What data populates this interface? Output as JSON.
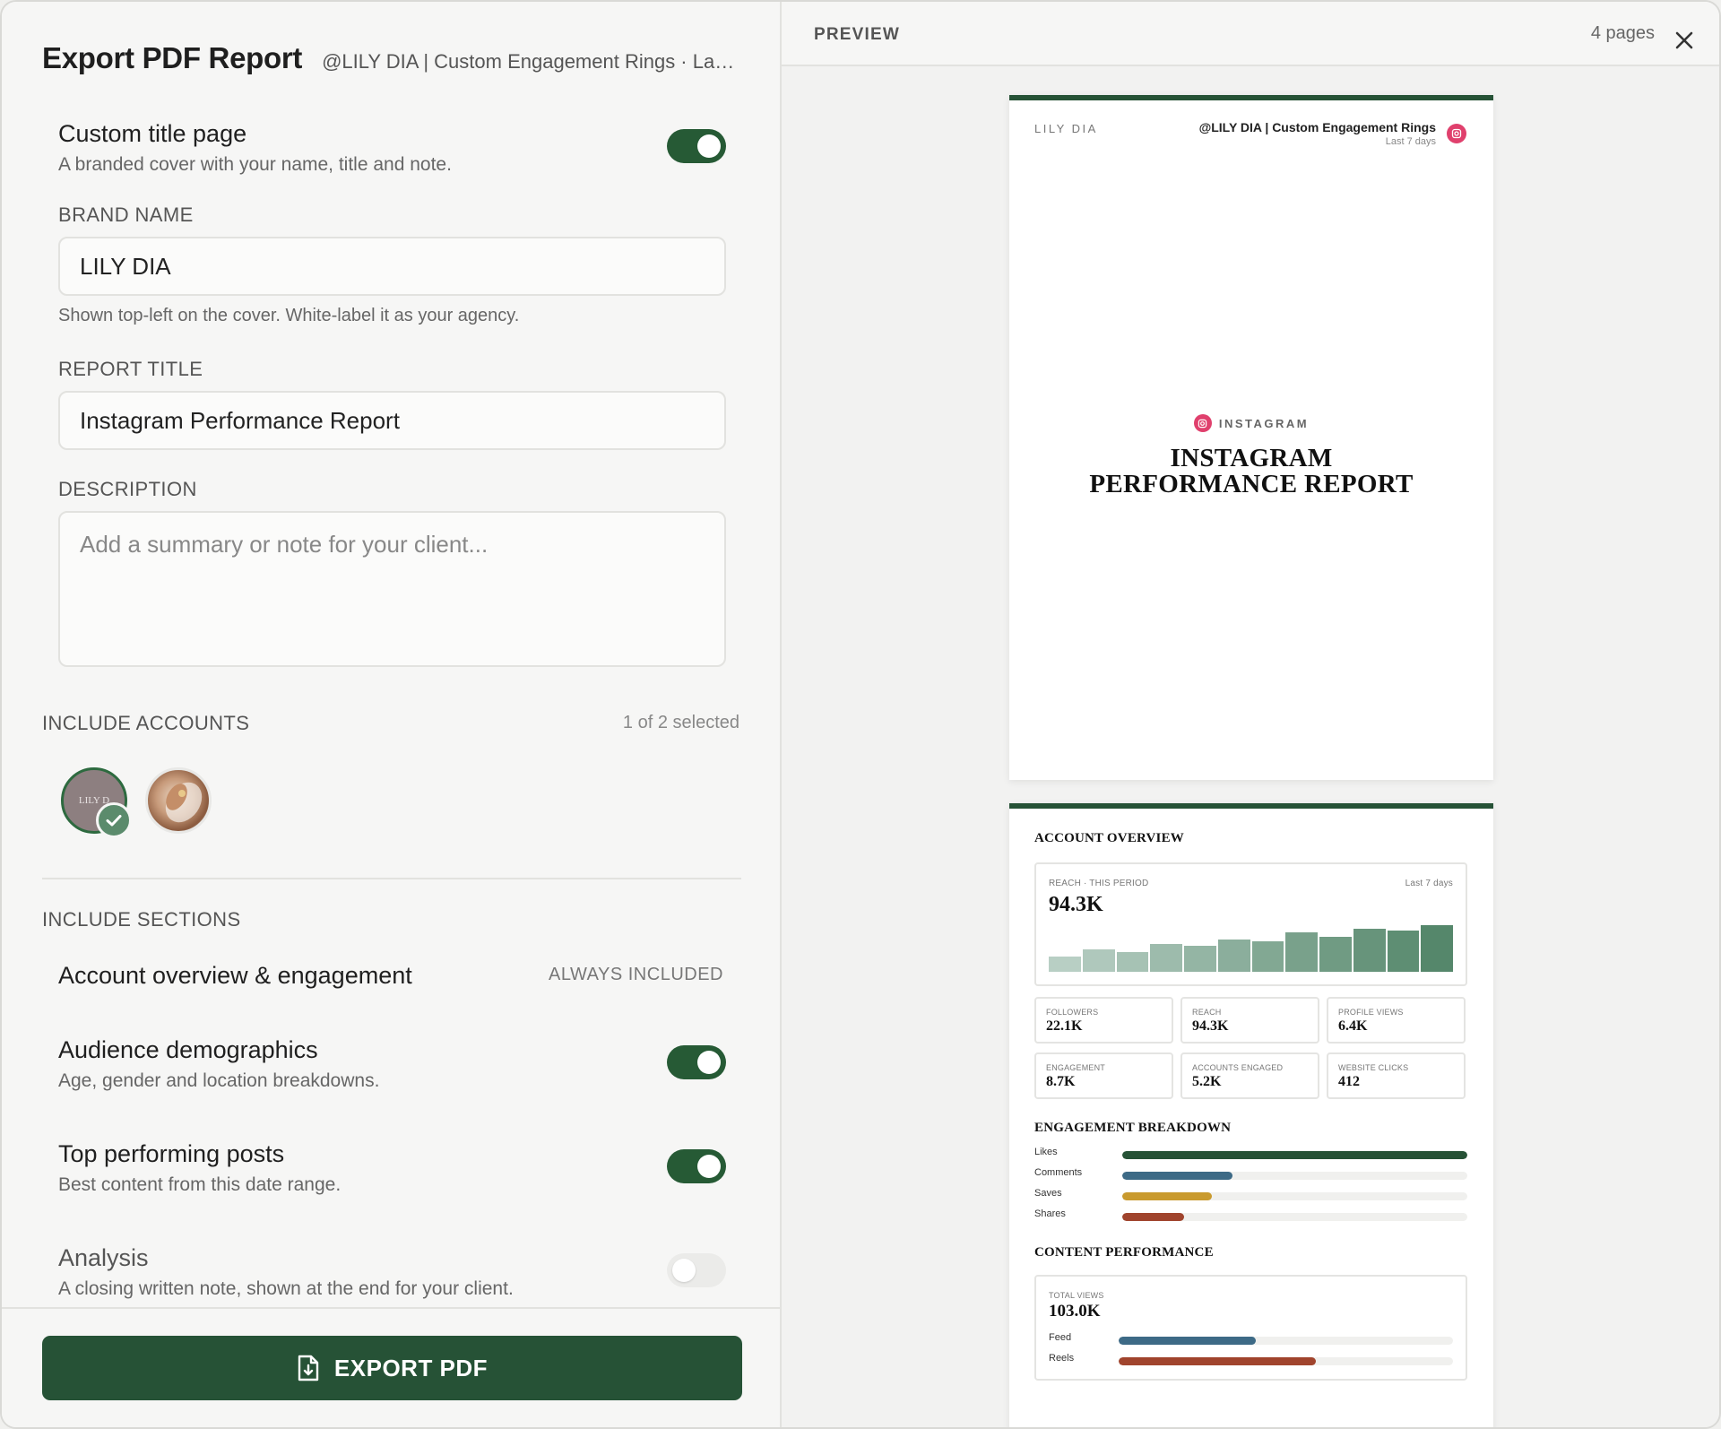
{
  "header": {
    "title": "Export PDF Report",
    "subtitle": "@LILY DIA | Custom Engagement Rings · Last ..."
  },
  "custom_title_page": {
    "title": "Custom title page",
    "description": "A branded cover with your name, title and note.",
    "enabled": true
  },
  "brand_name": {
    "label": "BRAND NAME",
    "value": "LILY DIA",
    "hint": "Shown top-left on the cover. White-label it as your agency."
  },
  "report_title": {
    "label": "REPORT TITLE",
    "value": "Instagram Performance Report"
  },
  "description": {
    "label": "DESCRIPTION",
    "placeholder": "Add a summary or note for your client..."
  },
  "accounts": {
    "label": "INCLUDE ACCOUNTS",
    "count": "1 of 2 selected",
    "items": [
      {
        "initials": "LILY D",
        "selected": true
      },
      {
        "initials": "",
        "selected": false
      }
    ]
  },
  "sections": {
    "label": "INCLUDE SECTIONS",
    "items": [
      {
        "title": "Account overview & engagement",
        "badge": "ALWAYS INCLUDED"
      },
      {
        "title": "Audience demographics",
        "description": "Age, gender and location breakdowns.",
        "enabled": true
      },
      {
        "title": "Top performing posts",
        "description": "Best content from this date range.",
        "enabled": true
      },
      {
        "title": "Analysis",
        "description": "A closing written note, shown at the end for your client.",
        "enabled": false
      }
    ]
  },
  "export_button": "EXPORT PDF",
  "preview": {
    "label": "PREVIEW",
    "pages": "4 pages",
    "cover": {
      "brand": "LILY DIA",
      "handle": "@LILY DIA | Custom Engagement Rings",
      "period": "Last 7 days",
      "platform": "INSTAGRAM",
      "title_line1": "INSTAGRAM",
      "title_line2": "PERFORMANCE REPORT"
    },
    "overview": {
      "heading": "ACCOUNT OVERVIEW",
      "reach_label": "REACH · THIS PERIOD",
      "reach_period": "Last 7 days",
      "reach_value": "94.3K",
      "reach_bars": [
        0.3,
        0.45,
        0.4,
        0.55,
        0.52,
        0.65,
        0.6,
        0.78,
        0.7,
        0.85,
        0.82,
        0.92
      ],
      "kpis": [
        {
          "label": "FOLLOWERS",
          "value": "22.1K"
        },
        {
          "label": "REACH",
          "value": "94.3K"
        },
        {
          "label": "PROFILE VIEWS",
          "value": "6.4K"
        },
        {
          "label": "ENGAGEMENT",
          "value": "8.7K"
        },
        {
          "label": "ACCOUNTS ENGAGED",
          "value": "5.2K"
        },
        {
          "label": "WEBSITE CLICKS",
          "value": "412"
        }
      ]
    },
    "engagement": {
      "heading": "ENGAGEMENT BREAKDOWN",
      "items": [
        {
          "label": "Likes",
          "value": 1.0,
          "color": "#265236"
        },
        {
          "label": "Comments",
          "value": 0.32,
          "color": "#3d6a86"
        },
        {
          "label": "Saves",
          "value": 0.26,
          "color": "#c99a2e"
        },
        {
          "label": "Shares",
          "value": 0.18,
          "color": "#a0442d"
        }
      ]
    },
    "content": {
      "heading": "CONTENT PERFORMANCE",
      "total_label": "TOTAL VIEWS",
      "total_value": "103.0K",
      "items": [
        {
          "label": "Feed",
          "value": 0.41,
          "color": "#3d6a86"
        },
        {
          "label": "Reels",
          "value": 0.59,
          "color": "#a0442d"
        }
      ]
    }
  }
}
